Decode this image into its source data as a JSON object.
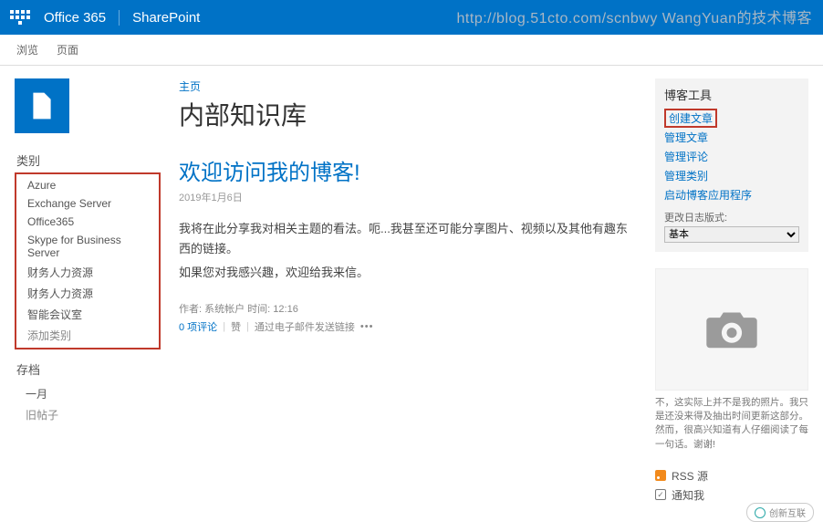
{
  "watermark": "http://blog.51cto.com/scnbwy WangYuan的技术博客",
  "suite": {
    "brand": "Office 365",
    "app": "SharePoint"
  },
  "tabs": {
    "browse": "浏览",
    "page": "页面"
  },
  "nav": {
    "categories_title": "类别",
    "categories": [
      {
        "label": "Azure"
      },
      {
        "label": "Exchange Server"
      },
      {
        "label": "Office365"
      },
      {
        "label": "Skype for Business Server"
      },
      {
        "label": "财务人力资源"
      },
      {
        "label": "财务人力资源"
      },
      {
        "label": "智能会议室"
      }
    ],
    "add_category": "添加类别",
    "archive_title": "存档",
    "archive": [
      {
        "label": "一月"
      }
    ],
    "older_posts": "旧帖子"
  },
  "header": {
    "home": "主页",
    "title": "内部知识库"
  },
  "post": {
    "title": "欢迎访问我的博客!",
    "date": "2019年1月6日",
    "p1": "我将在此分享我对相关主题的看法。呃...我甚至还可能分享图片、视频以及其他有趣东西的链接。",
    "p2": "如果您对我感兴趣，欢迎给我来信。",
    "meta": "作者: 系统帐户   时间: 12:16",
    "comments": "0 项评论",
    "like": "赞",
    "email": "通过电子邮件发送链接"
  },
  "tools": {
    "title": "博客工具",
    "items": [
      {
        "label": "创建文章",
        "hl": true
      },
      {
        "label": "管理文章"
      },
      {
        "label": "管理评论"
      },
      {
        "label": "管理类别"
      },
      {
        "label": "启动博客应用程序"
      }
    ],
    "format_label": "更改日志版式:",
    "format_selected": "基本"
  },
  "photo": {
    "caption": "不，这实际上并不是我的照片。我只是还没来得及抽出时间更新这部分。然而，很高兴知道有人仔细阅读了每一句话。谢谢!"
  },
  "rss": "RSS 源",
  "notify": "通知我",
  "brand_badge": "创新互联"
}
